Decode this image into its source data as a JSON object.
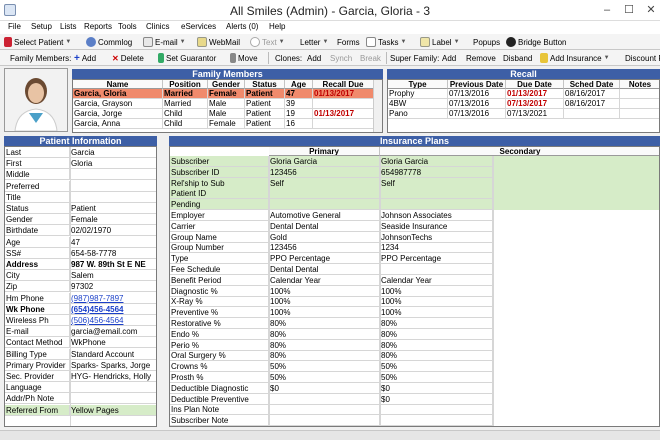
{
  "window": {
    "title": "All Smiles (Admin) - Garcia, Gloria - 3",
    "minimize": "–",
    "maximize": "☐",
    "close": "✕"
  },
  "menu": [
    "File",
    "Setup",
    "Lists",
    "Reports",
    "Tools",
    "Clinics",
    "eServices",
    "Alerts (0)",
    "Help"
  ],
  "toolbar": {
    "select_patient": "Select Patient",
    "commlog": "Commlog",
    "email": "E-mail",
    "webmail": "WebMail",
    "text": "Text",
    "letter": "Letter",
    "forms": "Forms",
    "tasks": "Tasks",
    "label": "Label",
    "popups": "Popups",
    "bridge": "Bridge Button"
  },
  "family_toolbar": {
    "family_members_label": "Family Members:",
    "add": "Add",
    "delete": "Delete",
    "set_guarantor": "Set Guarantor",
    "move": "Move",
    "clones_label": "Clones:",
    "clones_add": "Add",
    "synch": "Synch",
    "break": "Break",
    "super_family_label": "Super Family:",
    "sf_add": "Add",
    "sf_remove": "Remove",
    "sf_disband": "Disband",
    "add_insurance": "Add Insurance",
    "discount_plan": "Discount Pl"
  },
  "family": {
    "title": "Family Members",
    "columns": [
      "Name",
      "Position",
      "Gender",
      "Status",
      "Age",
      "Recall Due"
    ],
    "rows": [
      [
        "Garcia, Gloria",
        "Married",
        "Female",
        "Patient",
        "47",
        "01/13/2017"
      ],
      [
        "Garcia, Grayson",
        "Married",
        "Male",
        "Patient",
        "39",
        ""
      ],
      [
        "Garcia, Jorge",
        "Child",
        "Male",
        "Patient",
        "19",
        "01/13/2017"
      ],
      [
        "Garcia, Anna",
        "Child",
        "Female",
        "Patient",
        "16",
        ""
      ]
    ]
  },
  "recall": {
    "title": "Recall",
    "columns": [
      "Type",
      "Previous Date",
      "Due Date",
      "Sched Date",
      "Notes"
    ],
    "rows": [
      [
        "Prophy",
        "07/13/2016",
        "01/13/2017",
        "08/16/2017",
        ""
      ],
      [
        "4BW",
        "07/13/2016",
        "07/13/2017",
        "08/16/2017",
        ""
      ],
      [
        "Pano",
        "07/13/2016",
        "07/13/2021",
        "",
        ""
      ]
    ]
  },
  "patient_info": {
    "title": "Patient Information",
    "rows": [
      [
        "Last",
        "Garcia"
      ],
      [
        "First",
        "Gloria"
      ],
      [
        "Middle",
        ""
      ],
      [
        "Preferred",
        ""
      ],
      [
        "Title",
        ""
      ],
      [
        "Status",
        "Patient"
      ],
      [
        "Gender",
        "Female"
      ],
      [
        "Birthdate",
        "02/02/1970"
      ],
      [
        "Age",
        "47"
      ],
      [
        "SS#",
        "654-58-7778"
      ],
      [
        "Address",
        "987 W. 89th St E NE"
      ],
      [
        "City",
        "Salem"
      ],
      [
        "Zip",
        "97302"
      ],
      [
        "Hm Phone",
        "(987)987-7897"
      ],
      [
        "Wk Phone",
        "(654)456-4564"
      ],
      [
        "Wireless Ph",
        "(506)456-4564"
      ],
      [
        "E-mail",
        "garcia@email.com"
      ],
      [
        "Contact Method",
        "WkPhone"
      ],
      [
        "Billing Type",
        "Standard Account"
      ],
      [
        "Primary Provider",
        "Sparks- Sparks, Jorge"
      ],
      [
        "Sec. Provider",
        "HYG- Hendricks, Holly"
      ],
      [
        "Language",
        ""
      ],
      [
        "Addr/Ph Note",
        ""
      ],
      [
        "Referred From",
        "Yellow Pages"
      ]
    ]
  },
  "insurance": {
    "title": "Insurance Plans",
    "primary_label": "Primary",
    "secondary_label": "Secondary",
    "rows": [
      [
        "Subscriber",
        "Gloria Garcia",
        "Gloria Garcia"
      ],
      [
        "Subscriber ID",
        "123456",
        "654987778"
      ],
      [
        "Rel'ship to Sub",
        "Self",
        "Self"
      ],
      [
        "Patient ID",
        "",
        ""
      ],
      [
        "Pending",
        "",
        ""
      ],
      [
        "Employer",
        "Automotive General",
        "Johnson Associates"
      ],
      [
        "Carrier",
        "Dental Dental",
        "Seaside Insurance"
      ],
      [
        "Group Name",
        "Gold",
        "JohnsonTechs"
      ],
      [
        "Group Number",
        "123456",
        "1234"
      ],
      [
        "Type",
        "PPO Percentage",
        "PPO Percentage"
      ],
      [
        "Fee Schedule",
        "Dental Dental",
        ""
      ],
      [
        "Benefit Period",
        "Calendar Year",
        "Calendar Year"
      ],
      [
        "Diagnostic %",
        "100%",
        "100%"
      ],
      [
        "X-Ray %",
        "100%",
        "100%"
      ],
      [
        "Preventive %",
        "100%",
        "100%"
      ],
      [
        "Restorative %",
        "80%",
        "80%"
      ],
      [
        "Endo %",
        "80%",
        "80%"
      ],
      [
        "Perio %",
        "80%",
        "80%"
      ],
      [
        "Oral Surgery %",
        "80%",
        "80%"
      ],
      [
        "Crowns %",
        "50%",
        "50%"
      ],
      [
        "Prosth %",
        "50%",
        "50%"
      ],
      [
        "Deductible Diagnostic",
        "$0",
        "$0"
      ],
      [
        "Deductible Preventive",
        "",
        "$0"
      ],
      [
        "Ins Plan Note",
        "",
        ""
      ],
      [
        "Subscriber Note",
        "",
        ""
      ]
    ]
  },
  "colors": {
    "header": "#3d5fa6",
    "selected_row": "#f08a6c",
    "green_cell": "#d6ecc8",
    "red_text": "#c00000"
  }
}
